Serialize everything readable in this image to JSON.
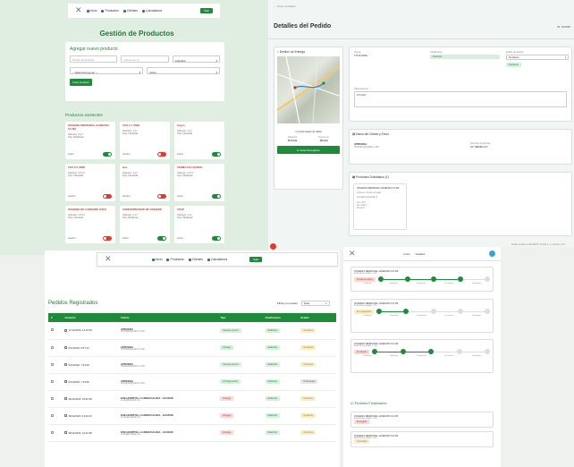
{
  "nav": {
    "inicio": "Inicio",
    "productos": "Productos",
    "clientes": "Clientes",
    "calculadora": "Calculadora",
    "salir": "Salir"
  },
  "products_page": {
    "title": "Gestión de Productos",
    "form_title": "Agregar nuevo producto",
    "name_placeholder": "Nombre del producto",
    "volume_placeholder": "Volumen en m³",
    "type_value": "Industrial",
    "category_value": "-- Selecciona grupo --",
    "status_value": "Activo",
    "add_button": "Crear producto",
    "list_title": "Productos existentes",
    "products": [
      {
        "name": "OXIGENO MEDICINAL GASEOSO 6,0 M3",
        "vol": "Volumen: 6 m³",
        "type": "Tipo: Medicinal",
        "status": "Activo",
        "on": true
      },
      {
        "name": "CO2 X 1 UNID",
        "vol": "Volumen: 1 m³",
        "type": "Tipo: Industrial",
        "status": "Inactivo",
        "on": false
      },
      {
        "name": "Argon",
        "vol": "Volumen: 1 m³",
        "type": "Tipo: Industrial",
        "status": "Activo",
        "on": true
      },
      {
        "name": "CO2 X 5 UNID",
        "vol": "Volumen: 5.5 m³",
        "type": "Tipo: Industrial",
        "status": "Inactivo",
        "on": false
      },
      {
        "name": "Gas",
        "vol": "Volumen: 1 m³",
        "type": "Tipo: Industrial",
        "status": "Inactivo",
        "on": false
      },
      {
        "name": "TERMO O2 LIQUIDO",
        "vol": "Volumen: 0.5 m³",
        "type": "Tipo: Medicinal",
        "status": "Activo",
        "on": true
      },
      {
        "name": "OXIGENO DE CARBONO (CO2)",
        "vol": "Volumen: 2.5 m³",
        "type": "Tipo: Industrial",
        "status": "Inactivo",
        "on": false
      },
      {
        "name": "CONCENTRADOR DE OXIGENO",
        "vol": "Volumen: 1 m³",
        "type": "Tipo: Medicinal",
        "status": "Activo",
        "on": true
      },
      {
        "name": "CPAP",
        "vol": "Volumen: 0 m³",
        "type": "Tipo: Medicinal",
        "status": "Activo",
        "on": true
      }
    ]
  },
  "details_page": {
    "back": "← Volver a Pedidos",
    "title": "Detalles del Pedido",
    "pedido_id": "ID: F00690",
    "map_section": "Destino de Entrega",
    "client_label": "Cliente",
    "client_value": "TITULAR/E",
    "class_label": "Clasificación",
    "class_value": "Medicinal",
    "status_label": "Estado del Pedido",
    "status_value": "Pendiente",
    "status_pill": "Pendiente",
    "obs_label": "Observaciones",
    "obs_value": "PRUEBA",
    "route_info": "Información de Ruta",
    "dist_label": "Distancia",
    "dist_value": "15.5 km",
    "time_label": "Tiempo est.",
    "time_value": "18 min",
    "start_nav": "Iniciar Navegación",
    "client_section": "Datos del Cliente y Envío",
    "client_name": "APRUEDA",
    "client_mail": "APRUEDA@GMAIL.COM",
    "addr_label": "Dirección de Entrega",
    "addr_value": "AV. MEDELLIN",
    "products_section": "Productos Solicitados (1)",
    "sol_name": "OXIGENO MEDICINAL GASEOSO 6,0 M3",
    "sol_vol": "Volumen: Desde de cajas",
    "sol_qty": "Cantidad Solicitada: 8",
    "sol_extra": [
      "Vol. m3 0",
      "Vol. total 0",
      "Precio 0"
    ],
    "footer": "Pedido creado el: 8/10/2025, 3:14:05 p. m. Versión 1.4.0"
  },
  "orders_page": {
    "title": "Pedidos Registrados",
    "filter_label": "Filtrar por estado:",
    "filter_value": "Todos",
    "columns": [
      "#",
      "Creación",
      "Cliente",
      "Tipo",
      "Clasificación",
      "Estado"
    ],
    "rows": [
      {
        "fecha": "17/12/2025, 14:15:35",
        "cliente": "APRUEDA",
        "mail": "APRUEDA@GMAIL.COM",
        "tipo": "Servicio externo",
        "clase": "Medicinal",
        "estado": "Pendiente",
        "tp": "g",
        "ep": "y"
      },
      {
        "fecha": "6/12/2025, 8:57:41",
        "cliente": "APRUEDA",
        "mail": "APRUEDA@GMAIL.COM",
        "tipo": "Entrega",
        "clase": "Medicinal",
        "estado": "Pendiente",
        "tp": "g",
        "ep": "y"
      },
      {
        "fecha": "6/12/2025, 7:23:25",
        "cliente": "APRUEDA",
        "mail": "APRUEDA@GMAIL.COM",
        "tipo": "Servicio externo",
        "clase": "Medicinal",
        "estado": "Pendiente",
        "tp": "g",
        "ep": "y"
      },
      {
        "fecha": "6/12/2025, 7:16:56",
        "cliente": "APRUEDA",
        "mail": "APRUEDA@GMAIL.COM",
        "tipo": "Entrega parcial",
        "clase": "Medicinal",
        "estado": "Procesando",
        "tp": "g",
        "ep": "gr"
      },
      {
        "fecha": "28/11/2025, 15:00:48",
        "cliente": "ESE HOSPITAL LA INMACULADA - GUADUE",
        "mail": "ventas@hospital.com",
        "tipo": "Entrega",
        "clase": "Medicinal",
        "estado": "Pendiente",
        "tp": "r",
        "ep": "y"
      },
      {
        "fecha": "28/11/2025, 14:30:43",
        "cliente": "ESE HOSPITAL LA INMACULADA - GUADUE",
        "mail": "ventas@hospital.com",
        "tipo": "Entrega",
        "clase": "Medicinal",
        "estado": "Pendiente",
        "tp": "r",
        "ep": "y"
      },
      {
        "fecha": "28/11/2025, 14:22:38",
        "cliente": "ESE HOSPITAL LA INMACULADA - GUADUE",
        "mail": "ventas@hospital.com",
        "tipo": "Entrega",
        "clase": "Medicinal",
        "estado": "Pendiente",
        "tp": "r",
        "ep": "y"
      }
    ]
  },
  "tracking_page": {
    "nav_inicio": "Inicio",
    "nav_pedidos": "Pedidos",
    "orders": [
      {
        "name": "OXIGENO MEDICINAL GASEOSO 6,0 M3",
        "meta": "APRUEDA@GMAIL.COM",
        "pill": "Pendiente activa",
        "done": 3
      },
      {
        "name": "OXIGENO MEDICINAL GASEOSO 6,0 M3",
        "meta": "APRUEDA@GMAIL.COM",
        "pill": "En preparación",
        "done": 1
      },
      {
        "name": "OXIGENO MEDICINAL GASEOSO 6,0 M3",
        "meta": "APRUEDA@GMAIL.COM",
        "pill": "En tránsito",
        "done": 2
      }
    ],
    "step_labels": [
      "Pendiente",
      "Aprobado",
      "Preparación",
      "En tránsito",
      "Entregado"
    ],
    "finished_title": "Pedidos Finalizados",
    "finished": [
      {
        "name": "OXIGENO MEDICINAL GASEOSO 6,0 M3",
        "meta": "APRUEDA@GMAIL.COM",
        "pill": "Entregado"
      },
      {
        "name": "OXIGENO MEDICINAL GASEOSO 6,0 M3",
        "meta": "APRUEDA@GMAIL.COM",
        "pill": "Cancelado"
      }
    ]
  }
}
